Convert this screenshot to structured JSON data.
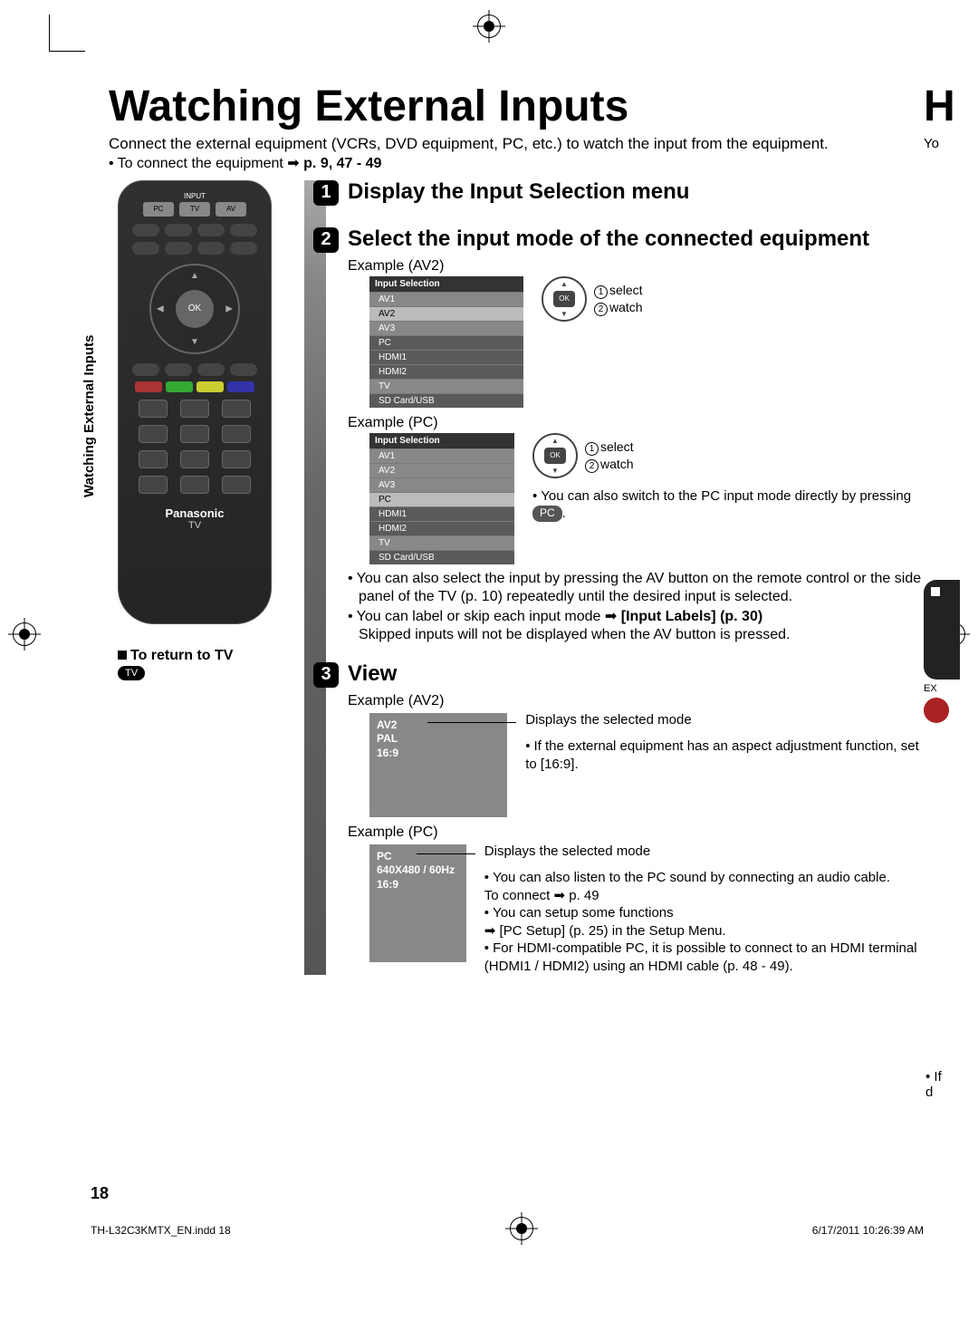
{
  "title": "Watching External Inputs",
  "intro": "Connect the external equipment (VCRs, DVD equipment, PC, etc.) to watch the input from the equipment.",
  "connect_prefix": "To connect the equipment ",
  "connect_ref": "p. 9, 47 - 49",
  "side_label": "Watching External Inputs",
  "remote": {
    "input_label": "INPUT",
    "pc": "PC",
    "tv": "TV",
    "av": "AV",
    "ok": "OK",
    "brand": "Panasonic",
    "brand_sub": "TV"
  },
  "return_tv": "To return to TV",
  "tv_pill": "TV",
  "steps": {
    "s1_num": "1",
    "s1_title": "Display the Input Selection menu",
    "s2_num": "2",
    "s2_title": "Select the input mode of the connected equipment",
    "s3_num": "3",
    "s3_title": "View"
  },
  "example_av2": "Example (AV2)",
  "example_pc": "Example (PC)",
  "menu": {
    "title": "Input Selection",
    "items": [
      "AV1",
      "AV2",
      "AV3",
      "PC",
      "HDMI1",
      "HDMI2",
      "TV",
      "SD Card/USB"
    ]
  },
  "hint": {
    "select": "select",
    "watch": "watch",
    "ok": "OK"
  },
  "pc_note_prefix": "You can also switch to the PC input mode directly by pressing ",
  "pc_note_pill": "PC",
  "step2_bullets": {
    "b1": "You can also select the input by pressing the AV button on the remote control or the side panel of the TV (p. 10) repeatedly until the desired input is selected.",
    "b2_prefix": "You can label or skip each input mode ",
    "b2_ref": "[Input Labels] (p. 30)",
    "b2_line2": "Skipped inputs will not be displayed when the AV button is pressed."
  },
  "view_av2": {
    "l1": "AV2",
    "l2": "PAL",
    "l3": "16:9"
  },
  "view_pc": {
    "l1": "PC",
    "l2": "640X480 / 60Hz",
    "l3": "16:9"
  },
  "view_side": {
    "displays": "Displays the selected mode",
    "av2_b1": "If the external equipment has an aspect adjustment function, set to [16:9].",
    "pc_b1a": "You can also listen to the PC sound by connecting an audio cable.",
    "pc_b1b": "To connect ➡ p. 49",
    "pc_b2": "You can setup some functions\n➡ [PC Setup] (p. 25) in the Setup Menu.",
    "pc_b3": "For HDMI-compatible PC, it is possible to connect to an HDMI terminal (HDMI1 / HDMI2) using an HDMI cable (p. 48 - 49)."
  },
  "page_number": "18",
  "footer_left": "TH-L32C3KMTX_EN.indd   18",
  "footer_right": "6/17/2011   10:26:39 AM",
  "cut": {
    "yo": "Yo",
    "ex": "EX",
    "if1": "• If",
    "if2": "  d"
  }
}
